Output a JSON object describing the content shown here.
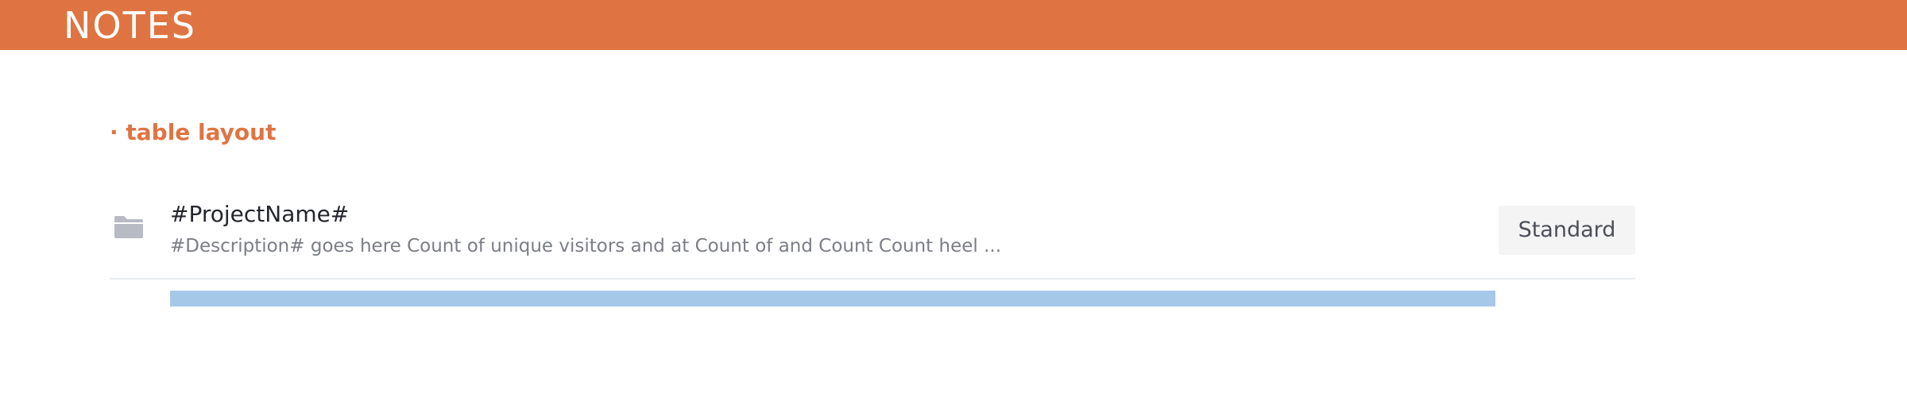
{
  "header": {
    "title": "NOTES"
  },
  "section": {
    "label": "· table layout"
  },
  "project": {
    "icon": "folder-icon",
    "name": "#ProjectName#",
    "description": "#Description# goes here Count of unique visitors and at Count of and Count Count heel ...",
    "plan": "Standard",
    "progress": 1.0
  },
  "colors": {
    "accent": "#df7442",
    "progress": "#a6c8e8",
    "divider": "#e6ebee",
    "badge_bg": "#f4f4f5",
    "icon": "#b8bbc4"
  }
}
